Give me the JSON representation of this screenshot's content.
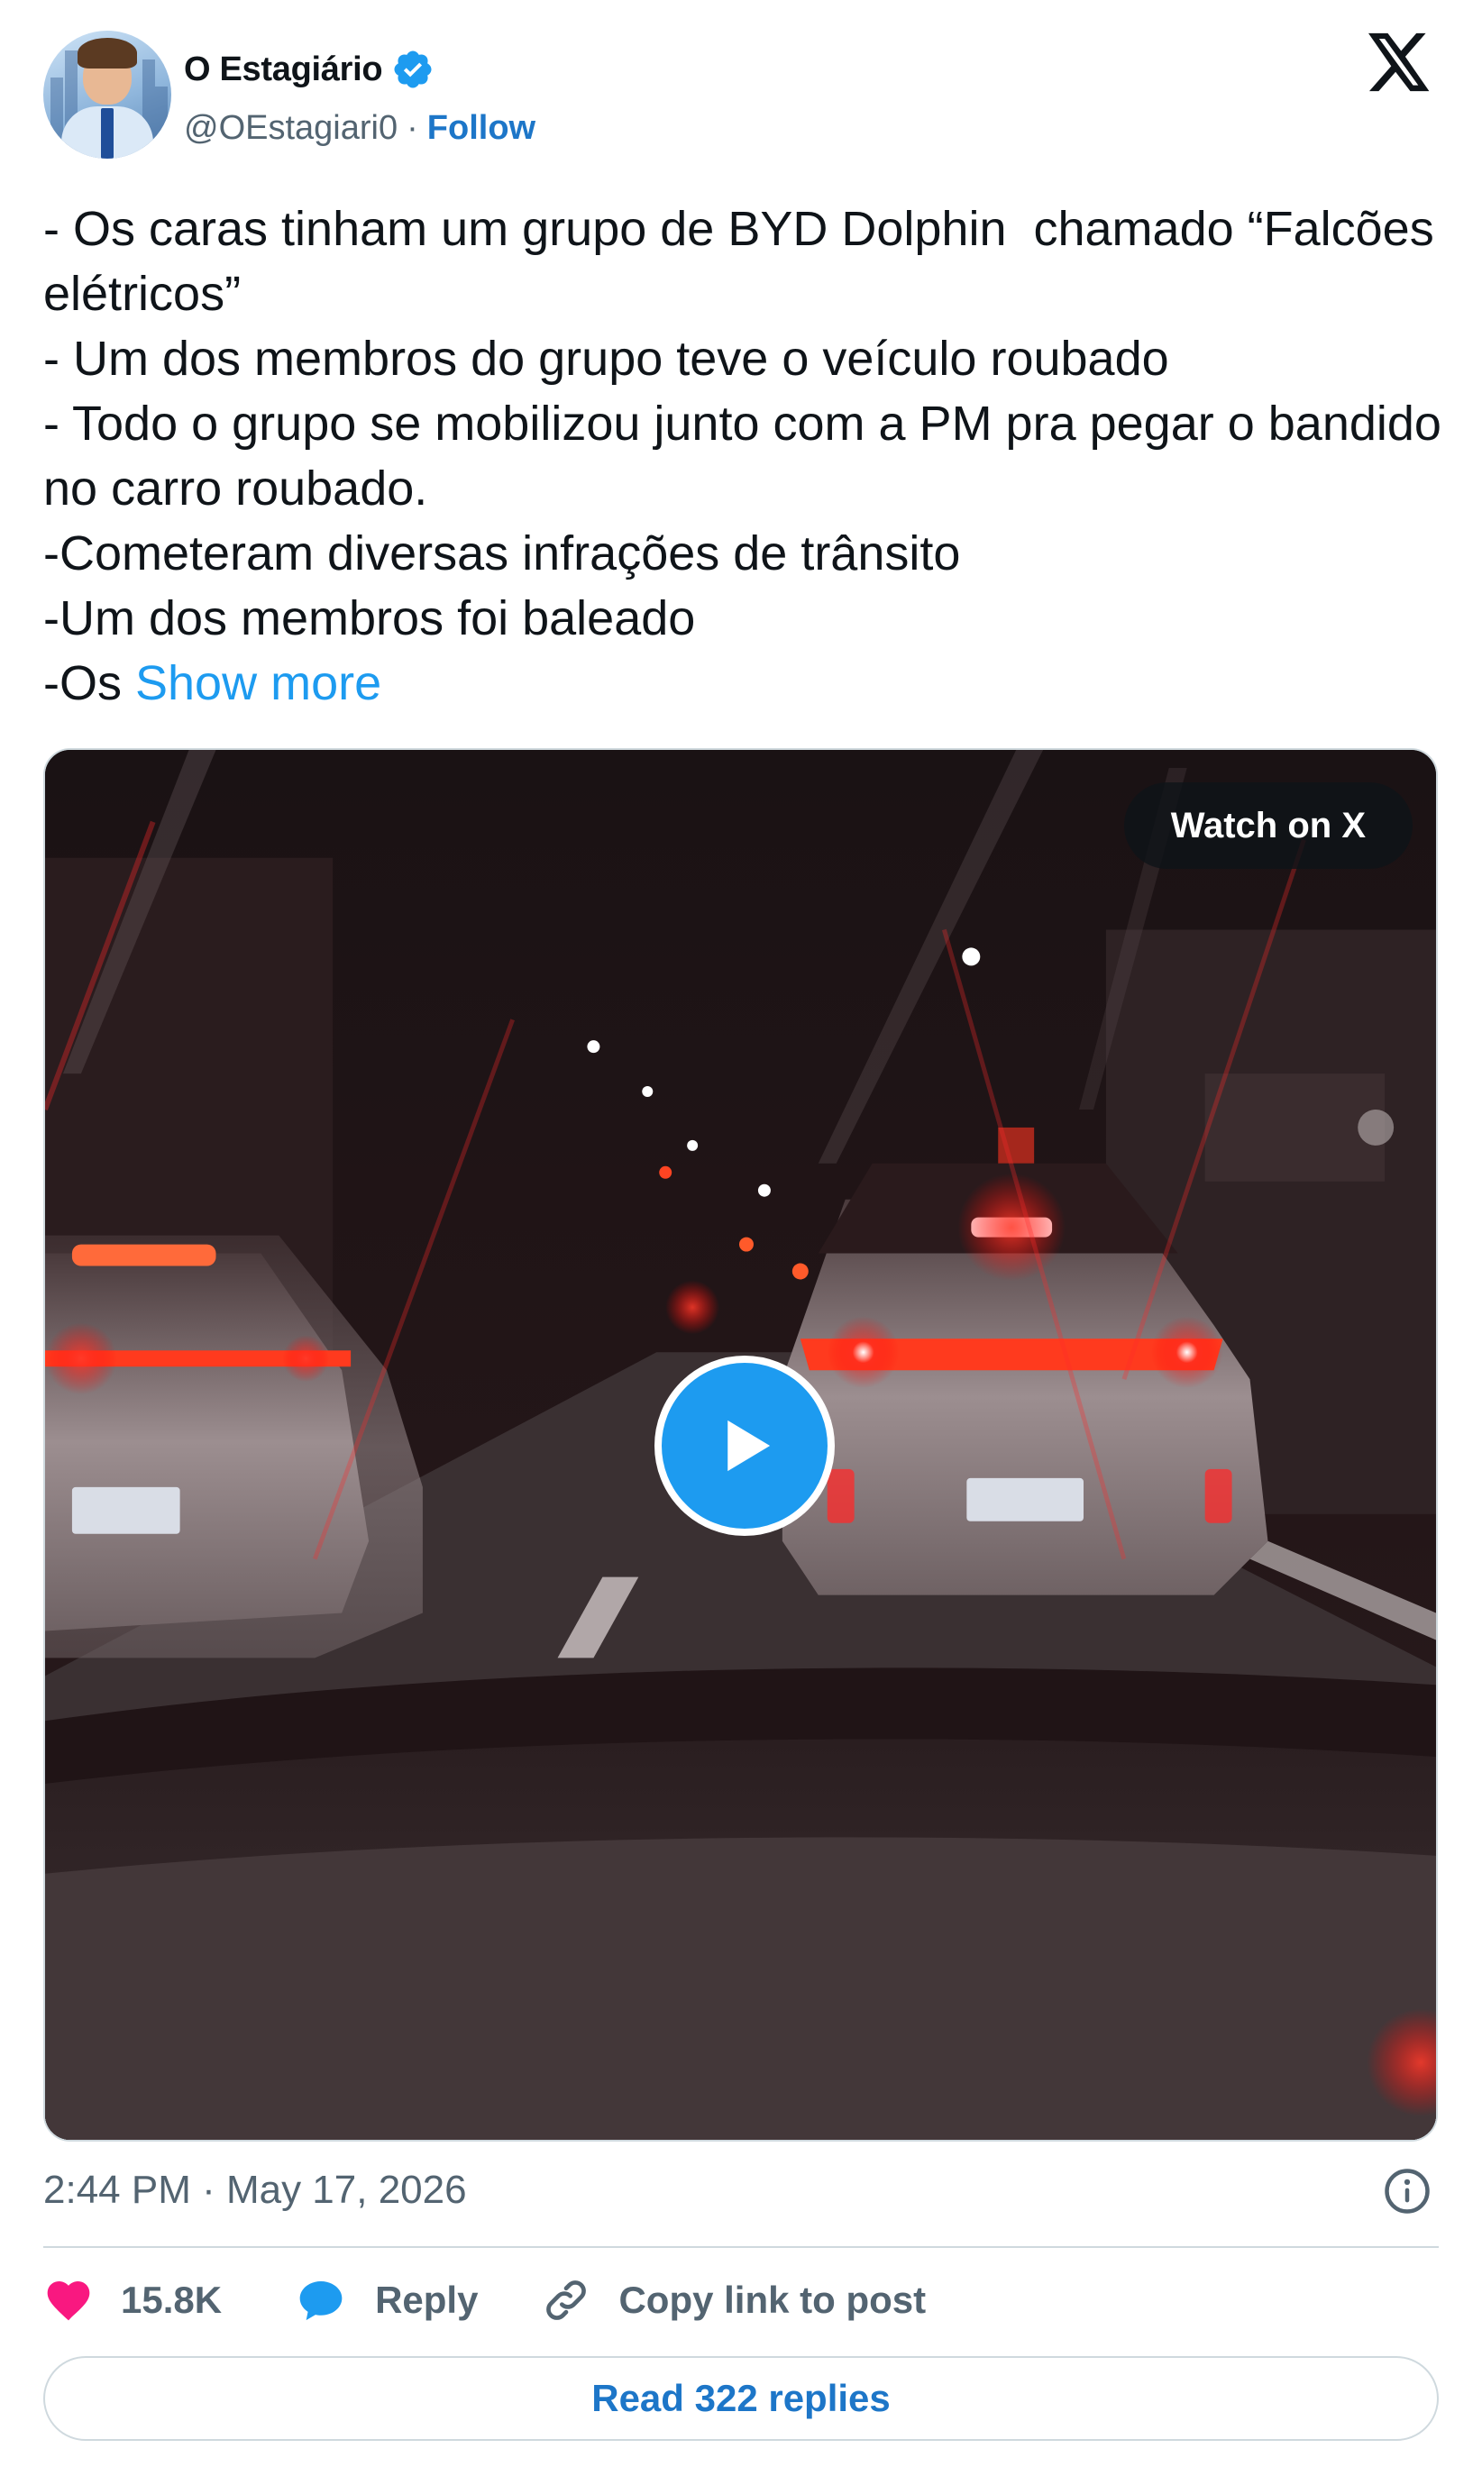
{
  "author": {
    "name": "O Estagiário",
    "handle": "@OEstagiari0",
    "separator": "·",
    "follow_label": "Follow",
    "verified_color": "#1d9bf0"
  },
  "tweet": {
    "text": "- Os caras tinham um grupo de BYD Dolphin  chamado “Falcões elétricos”\n- Um dos membros do grupo teve o veículo roubado\n- Todo o grupo se mobilizou junto com a PM pra pegar o bandido no carro roubado.\n-Cometeram diversas infrações de trânsito\n-Um dos membros foi baleado\n-Os ",
    "show_more_label": "Show more"
  },
  "media": {
    "watch_label": "Watch on X",
    "play_icon": "play-icon"
  },
  "meta": {
    "timestamp": "2:44 PM · May 17, 2026"
  },
  "actions": {
    "likes": "15.8K",
    "reply_label": "Reply",
    "copy_link_label": "Copy link to post",
    "read_replies_label": "Read 322 replies"
  },
  "colors": {
    "accent": "#1d9bf0",
    "link": "#1d76c8",
    "like": "#f91880",
    "muted": "#536471"
  }
}
